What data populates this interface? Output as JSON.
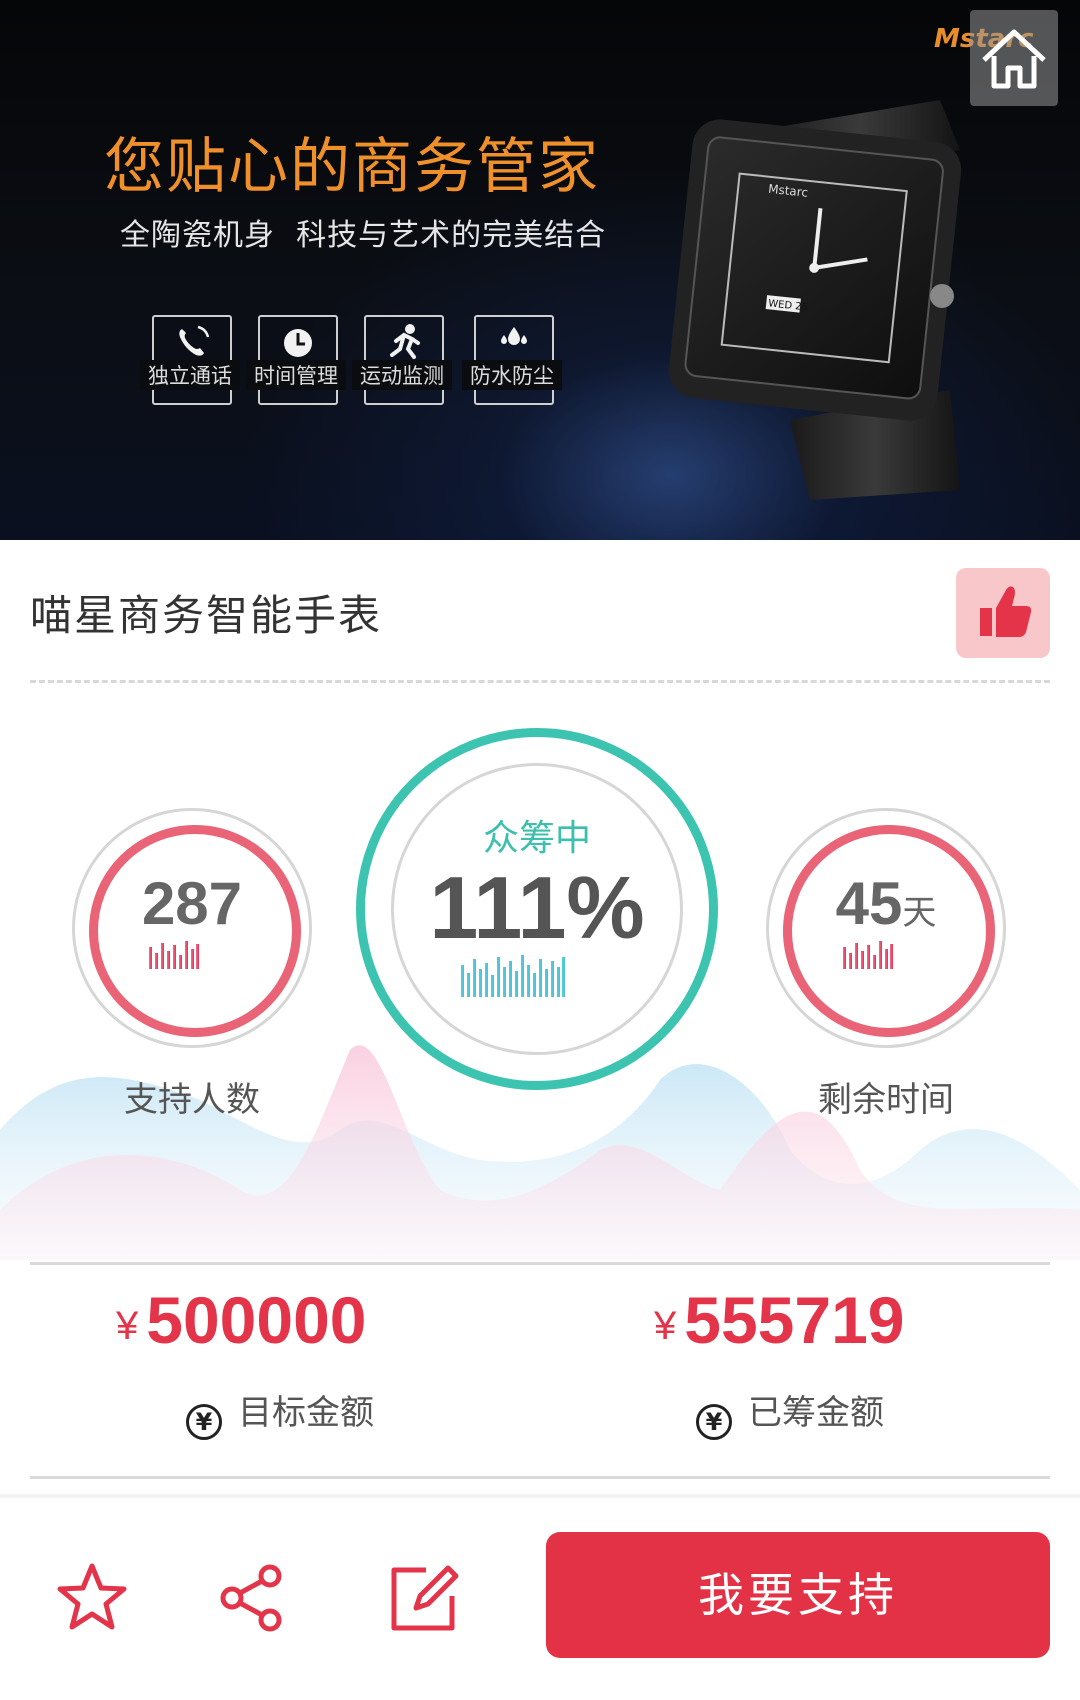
{
  "banner": {
    "brand": "Mstarc",
    "headline": "您贴心的商务管家",
    "subline": "全陶瓷机身  科技与艺术的完美结合",
    "features": [
      "独立通话",
      "时间管理",
      "运动监测",
      "防水防尘"
    ],
    "watch_face_brand": "Mstarc",
    "watch_date": "WED 25",
    "home_icon": "home-icon"
  },
  "product": {
    "title": "喵星商务智能手表",
    "like_icon": "thumbs-up-icon"
  },
  "stats": {
    "supporters": {
      "value": "287",
      "label": "支持人数"
    },
    "funding": {
      "status": "众筹中",
      "percent": "111%"
    },
    "remaining": {
      "value": "45",
      "unit": "天",
      "label": "剩余时间"
    }
  },
  "amounts": {
    "currency_symbol": "¥",
    "currency_icon": "¥",
    "target": {
      "value": "500000",
      "label": "目标金额"
    },
    "raised": {
      "value": "555719",
      "label": "已筹金额"
    }
  },
  "bottom_bar": {
    "icons": [
      "star-icon",
      "share-icon",
      "edit-icon"
    ],
    "support_button": "我要支持"
  },
  "colors": {
    "accent_red": "#e33245",
    "teal": "#3dc4b0",
    "ring_pink": "#e96476",
    "banner_orange": "#f0902a"
  }
}
